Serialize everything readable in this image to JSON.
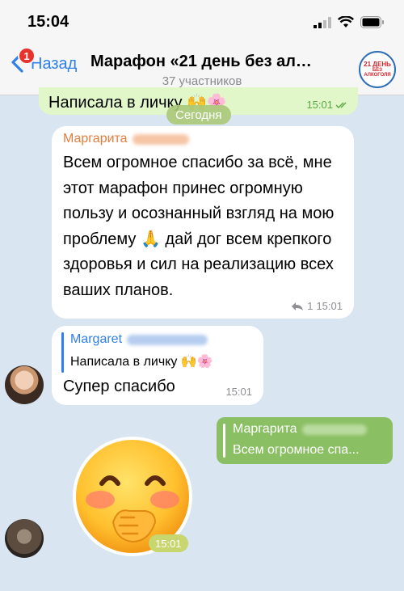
{
  "status_bar": {
    "time": "15:04"
  },
  "nav": {
    "back_label": "Назад",
    "unread_count": "1",
    "title": "Марафон «21 день без ал…",
    "subtitle": "37 участников",
    "avatar_line1": "21 ДЕНЬ",
    "avatar_line2": "БЕЗ АЛКОГОЛЯ"
  },
  "messages": {
    "outgoing_top": {
      "text": "Написала в личку 🙌🌸",
      "time": "15:01"
    },
    "date_divider": "Сегодня",
    "incoming_1": {
      "sender": "Маргарита",
      "text": "Всем огромное спасибо за всё, мне этот марафон принес огромную пользу и осознанный взгляд на мою проблему 🙏 дай дог всем крепкого здоровья и сил на реализацию всех ваших планов.",
      "reply_count": "1",
      "time": "15:01"
    },
    "incoming_2": {
      "reply_sender": "Margaret",
      "reply_text": "Написала в личку 🙌🌸",
      "text": "Супер спасибо",
      "time": "15:01"
    },
    "outgoing_reply": {
      "name": "Маргарита",
      "text": "Всем огромное спа..."
    },
    "sticker": {
      "time": "15:01"
    }
  },
  "colors": {
    "accent": "#2f80e8",
    "sender_orange": "#e27d3d",
    "outgoing_green": "#8bbf64",
    "chat_bg": "#d9e6f2"
  }
}
